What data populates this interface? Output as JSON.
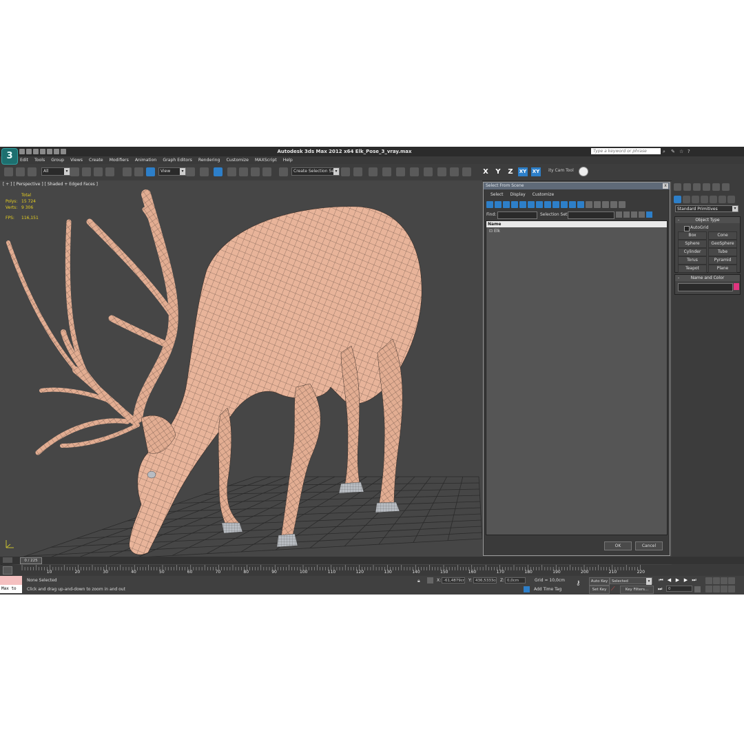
{
  "titlebar": {
    "logo": "3",
    "title": "Autodesk 3ds Max  2012 x64    Elk_Pose_3_vray.max",
    "search_placeholder": "Type a keyword or phrase",
    "icons": [
      "binoculars-icon",
      "tools-icon",
      "star-icon",
      "help-icon"
    ]
  },
  "menu": [
    "Edit",
    "Tools",
    "Group",
    "Views",
    "Create",
    "Modifiers",
    "Animation",
    "Graph Editors",
    "Rendering",
    "Customize",
    "MAXScript",
    "Help"
  ],
  "toolbar": {
    "filter_select": "All",
    "ref_coord": "View",
    "selection_set": "Create Selection Se",
    "axis_x": "X",
    "axis_y": "Y",
    "axis_z": "Z",
    "axis_xy": "XY",
    "axis_xy2": "XY",
    "cam_tool": "ity Cam Tool"
  },
  "viewport": {
    "label": "[ + ] [ Perspective ] [ Shaded + Edged Faces ]",
    "stats_header": "Total",
    "polys_label": "Polys:",
    "polys_value": "15 724",
    "verts_label": "Verts:",
    "verts_value": "9 306",
    "fps_label": "FPS:",
    "fps_value": "116,151",
    "colors": {
      "background": "#464646",
      "mesh": "#e8b49a",
      "wire": "#4a3a32",
      "hoof": "#b8bcc2",
      "grid": "#2a2a2a"
    }
  },
  "dialog": {
    "title": "Select From Scene",
    "close": "x",
    "menu": [
      "Select",
      "Display",
      "Customize"
    ],
    "find_label": "Find:",
    "selection_set_label": "Selection Set:",
    "list_header": "Name",
    "items": [
      "Elk"
    ],
    "ok": "OK",
    "cancel": "Cancel"
  },
  "command_panel": {
    "dropdown": "Standard Primitives",
    "object_type_header": "Object Type",
    "autogrid": "AutoGrid",
    "primitives": [
      "Box",
      "Cone",
      "Sphere",
      "GeoSphere",
      "Cylinder",
      "Tube",
      "Torus",
      "Pyramid",
      "Teapot",
      "Plane"
    ],
    "name_color_header": "Name and Color",
    "swatch_color": "#e0357f",
    "minus": "-"
  },
  "timeline": {
    "slider": "0 / 225",
    "ticks": [
      "10",
      "20",
      "30",
      "40",
      "50",
      "60",
      "70",
      "80",
      "90",
      "100",
      "110",
      "120",
      "130",
      "140",
      "150",
      "160",
      "170",
      "180",
      "190",
      "200",
      "210",
      "220"
    ]
  },
  "status": {
    "maxscript": "Max to",
    "selection": "None Selected",
    "prompt": "Click and drag up-and-down to zoom in and out",
    "x_label": "X:",
    "x_value": "-61,4879cm",
    "y_label": "Y:",
    "y_value": "436,5333cm",
    "z_label": "Z:",
    "z_value": "0,0cm",
    "grid": "Grid = 10,0cm",
    "add_time_tag": "Add Time Tag",
    "auto_key": "Auto Key",
    "set_key": "Set Key",
    "selected": "Selected",
    "key_filters": "Key Filters...",
    "frame": "0"
  }
}
